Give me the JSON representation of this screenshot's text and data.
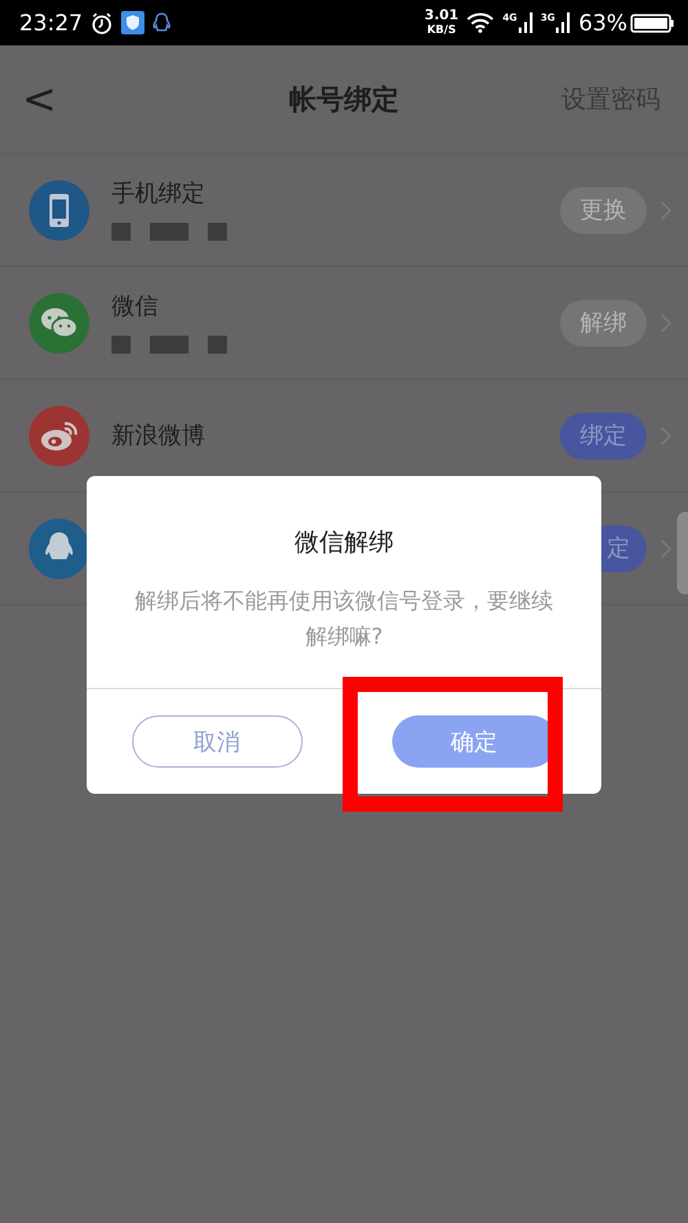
{
  "status_bar": {
    "time": "23:27",
    "speed": "3.01",
    "speed_unit": "KB/S",
    "net_1": "4G",
    "net_2": "3G",
    "battery": "63%"
  },
  "nav": {
    "back": "<",
    "title": "帐号绑定",
    "action": "设置密码"
  },
  "accounts": [
    {
      "kind": "phone",
      "name": "手机绑定",
      "color": "#1f5787",
      "redacted": true,
      "button": "更换",
      "bound": true
    },
    {
      "kind": "wechat",
      "name": "微信",
      "color": "#2b7136",
      "redacted": true,
      "button": "解绑",
      "bound": true
    },
    {
      "kind": "weibo",
      "name": "新浪微博",
      "color": "#9c3531",
      "redacted": false,
      "button": "绑定",
      "bound": false
    },
    {
      "kind": "qq",
      "color": "#1f5d8a",
      "redacted": false,
      "button": "定",
      "bound": false
    }
  ],
  "dialog": {
    "title": "微信解绑",
    "message": "解绑后将不能再使用该微信号登录，要继续解绑嘛?",
    "cancel": "取消",
    "confirm": "确定"
  }
}
